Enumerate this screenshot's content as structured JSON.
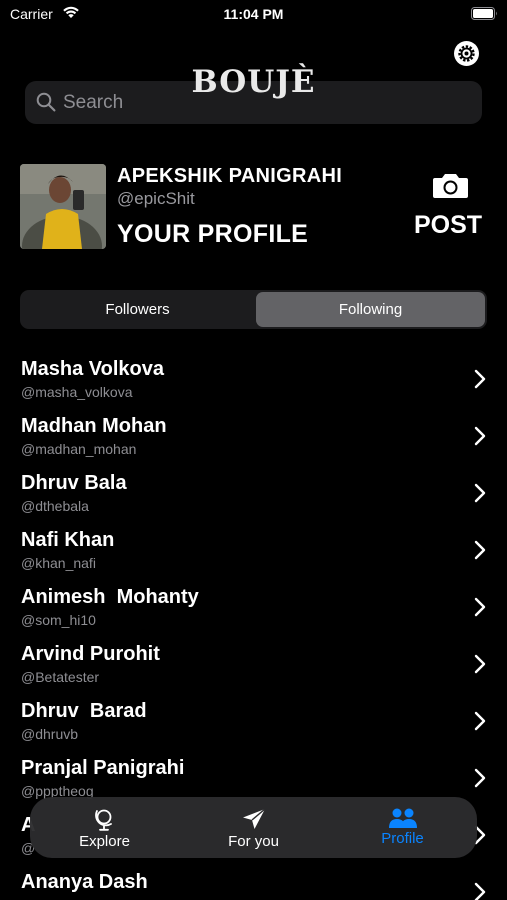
{
  "status_bar": {
    "carrier": "Carrier",
    "time": "11:04 PM"
  },
  "header": {
    "brand": "BOUJÈ"
  },
  "search": {
    "placeholder": "Search"
  },
  "profile": {
    "name": "APEKSHIK PANIGRAHI",
    "handle": "@epicShit",
    "title": "YOUR PROFILE",
    "post_label": "POST"
  },
  "segments": {
    "followers": "Followers",
    "following": "Following",
    "selected": "Following"
  },
  "following": [
    {
      "name": "Masha Volkova",
      "handle": "@masha_volkova"
    },
    {
      "name": "Madhan Mohan",
      "handle": "@madhan_mohan"
    },
    {
      "name": "Dhruv Bala",
      "handle": "@dthebala"
    },
    {
      "name": "Nafi Khan",
      "handle": "@khan_nafi"
    },
    {
      "name": "Animesh  Mohanty",
      "handle": "@som_hi10"
    },
    {
      "name": "Arvind Purohit",
      "handle": "@Betatester"
    },
    {
      "name": "Dhruv  Barad",
      "handle": "@dhruvb"
    },
    {
      "name": "Pranjal Panigrahi",
      "handle": "@ppptheog"
    },
    {
      "name": "A",
      "handle": "@"
    },
    {
      "name": "Ananya Dash",
      "handle": ""
    }
  ],
  "tab_bar": {
    "explore": "Explore",
    "for_you": "For you",
    "profile": "Profile",
    "active": "Profile",
    "active_color": "#0a84ff"
  },
  "icons": {
    "wifi": "wifi-icon",
    "battery": "battery-icon",
    "settings": "gear-icon",
    "search": "search-icon",
    "camera": "camera-icon",
    "chevron": "chevron-right-icon",
    "explore": "globe-icon",
    "for_you": "paper-plane-icon",
    "profile": "people-icon"
  }
}
